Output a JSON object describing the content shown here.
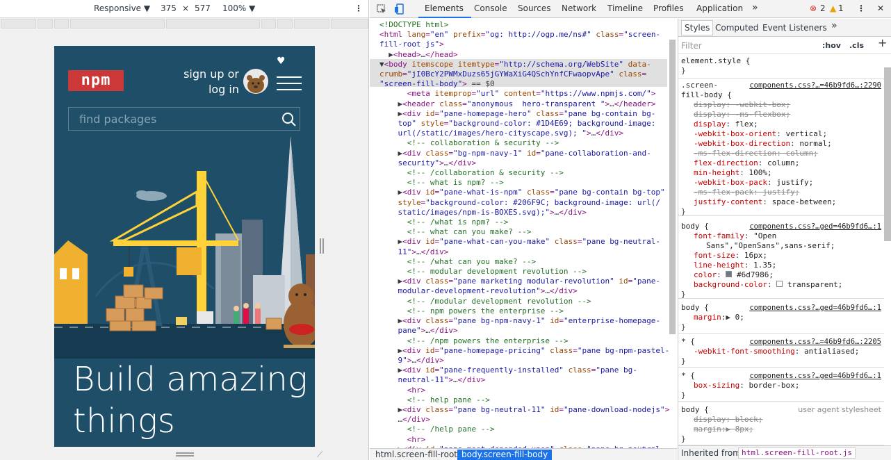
{
  "devbar": {
    "device": "Responsive ▼",
    "width": "375",
    "times": "×",
    "height": "577",
    "zoom": "100% ▼"
  },
  "page": {
    "logo": "npm",
    "signup": "sign up or",
    "login": "log in",
    "search_placeholder": "find packages",
    "hero_line1": "Build amazing",
    "hero_line2": "things"
  },
  "devtools": {
    "tabs": [
      "Elements",
      "Console",
      "Sources",
      "Network",
      "Timeline",
      "Profiles",
      "Application"
    ],
    "more": "»",
    "errors": "2",
    "warnings": "1",
    "breadcrumbs": [
      "html.screen-fill-root.js",
      "body.screen-fill-body"
    ]
  },
  "styles": {
    "tabs": [
      "Styles",
      "Computed",
      "Event Listeners"
    ],
    "more": "»",
    "filter": "Filter",
    "hov": ":hov",
    "cls": ".cls",
    "plus": "+",
    "inherited_label": "Inherited from",
    "inherited_value": "html.screen-fill-root.js"
  },
  "colors": {
    "hero_bg": "#1F4E69",
    "npm_red": "#cb3837",
    "selection": "#e0e0e0",
    "accent_blue": "#1a73e8"
  }
}
